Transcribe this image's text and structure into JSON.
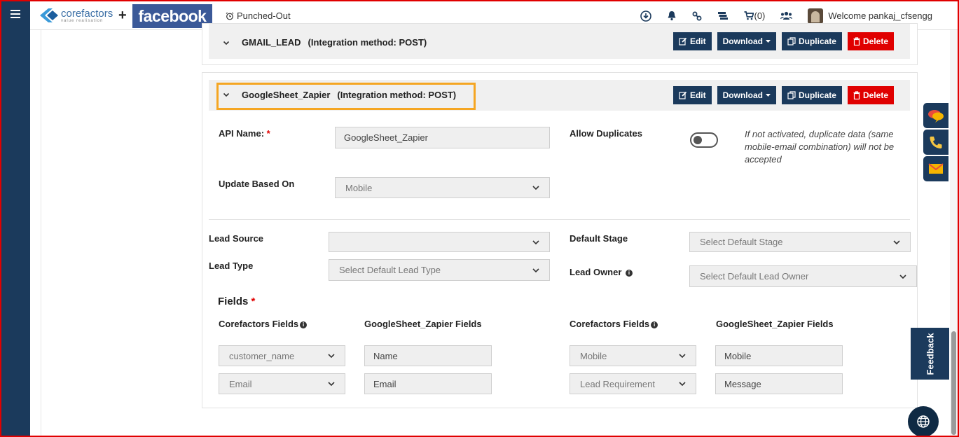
{
  "header": {
    "logo_text": "corefactors",
    "logo_tagline": "value realisation",
    "plus": "+",
    "facebook_logo": "facebook",
    "punch_status": "Punched-Out",
    "cart_count": "(0)",
    "welcome": "Welcome pankaj_cfsengg"
  },
  "integrations": [
    {
      "name": "GMAIL_LEAD",
      "method": "(Integration method: POST)"
    },
    {
      "name": "GoogleSheet_Zapier",
      "method": "(Integration method: POST)"
    }
  ],
  "buttons": {
    "edit": "Edit",
    "download": "Download",
    "duplicate": "Duplicate",
    "delete": "Delete"
  },
  "form": {
    "api_name_label": "API Name:",
    "required_mark": "*",
    "api_name_value": "GoogleSheet_Zapier",
    "allow_duplicates_label": "Allow Duplicates",
    "allow_duplicates_on": false,
    "allow_duplicates_note": "If not activated, duplicate data (same mobile-email combination) will not be accepted",
    "update_based_on_label": "Update Based On",
    "update_based_on_value": "Mobile",
    "lead_source_label": "Lead Source",
    "lead_source_value": "",
    "default_stage_label": "Default Stage",
    "default_stage_placeholder": "Select Default Stage",
    "lead_type_label": "Lead Type",
    "lead_type_placeholder": "Select Default Lead Type",
    "lead_owner_label": "Lead Owner",
    "lead_owner_placeholder": "Select Default Lead Owner"
  },
  "fields": {
    "heading": "Fields",
    "col_corefactors": "Corefactors Fields",
    "col_source": "GoogleSheet_Zapier Fields",
    "left_rows": [
      {
        "cf": "customer_name",
        "src": "Name"
      },
      {
        "cf": "Email",
        "src": "Email"
      }
    ],
    "right_rows": [
      {
        "cf": "Mobile",
        "src": "Mobile"
      },
      {
        "cf": "Lead Requirement",
        "src": "Message"
      }
    ]
  },
  "widgets": {
    "feedback": "Feedback"
  },
  "colors": {
    "navy": "#1b3a5c",
    "danger": "#e00000",
    "highlight": "#f5a623",
    "facebook": "#3b5998"
  }
}
